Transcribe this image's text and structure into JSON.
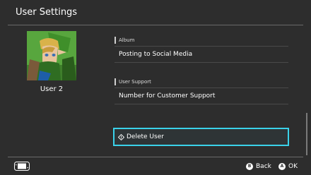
{
  "header": {
    "title": "User Settings"
  },
  "user": {
    "name": "User 2",
    "avatar_icon": "link-character-avatar"
  },
  "sections": {
    "album": {
      "header": "Album",
      "item": "Posting to Social Media"
    },
    "user_support": {
      "header": "User Support",
      "item": "Number for Customer Support"
    }
  },
  "actions": {
    "delete_user": "Delete User",
    "delete_icon": "warning-diamond-icon"
  },
  "footer": {
    "console_icon": "switch-console-icon",
    "back_button_glyph": "B",
    "back_label": "Back",
    "ok_button_glyph": "A",
    "ok_label": "OK"
  },
  "colors": {
    "background": "#2d2d2d",
    "focus_highlight": "#3ad2ea",
    "divider": "#6a6a6a"
  }
}
